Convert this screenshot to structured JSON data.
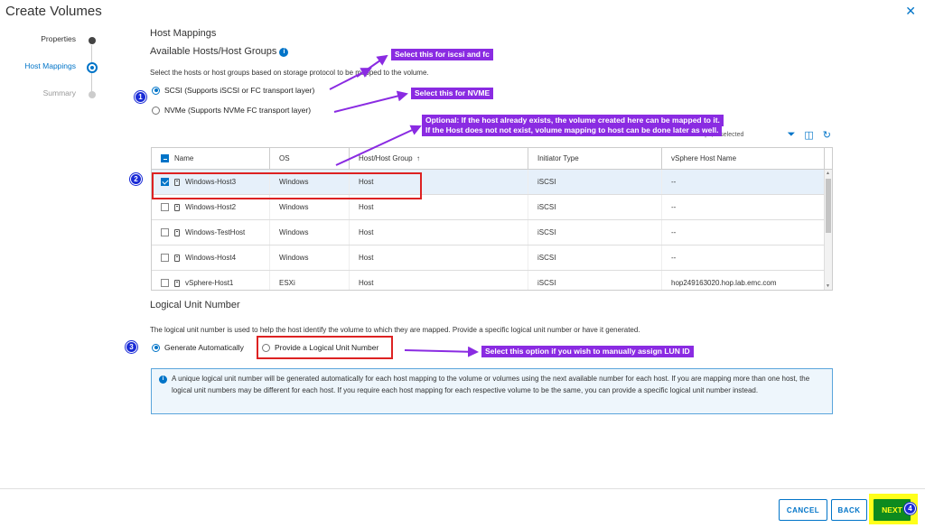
{
  "dialog": {
    "title": "Create Volumes",
    "close_icon": "close-icon"
  },
  "steps": [
    {
      "label": "Properties",
      "state": "done"
    },
    {
      "label": "Host Mappings",
      "state": "active"
    },
    {
      "label": "Summary",
      "state": "future"
    }
  ],
  "section": {
    "heading": "Host Mappings",
    "subheading": "Available Hosts/Host Groups",
    "description": "Select the hosts or host groups based on storage protocol to be mapped to the volume.",
    "protocol_options": [
      {
        "label": "SCSI (Supports iSCSI or FC transport layer)",
        "selected": true
      },
      {
        "label": "NVMe (Supports NVMe FC transport layer)",
        "selected": false
      }
    ],
    "count_text": "5 Hosts & Host Groups, 1 selected"
  },
  "table": {
    "columns": [
      "Name",
      "OS",
      "Host/Host Group",
      "Initiator Type",
      "vSphere Host Name"
    ],
    "sort_indicator": "↑",
    "rows": [
      {
        "name": "Windows-Host3",
        "os": "Windows",
        "group": "Host",
        "initiator": "iSCSI",
        "vsphere": "--",
        "checked": true
      },
      {
        "name": "Windows-Host2",
        "os": "Windows",
        "group": "Host",
        "initiator": "iSCSI",
        "vsphere": "--",
        "checked": false
      },
      {
        "name": "Windows-TestHost",
        "os": "Windows",
        "group": "Host",
        "initiator": "iSCSI",
        "vsphere": "--",
        "checked": false
      },
      {
        "name": "Windows-Host4",
        "os": "Windows",
        "group": "Host",
        "initiator": "iSCSI",
        "vsphere": "--",
        "checked": false
      },
      {
        "name": "vSphere-Host1",
        "os": "ESXi",
        "group": "Host",
        "initiator": "iSCSI",
        "vsphere": "hop249163020.hop.lab.emc.com",
        "checked": false
      }
    ]
  },
  "lun": {
    "heading": "Logical Unit Number",
    "description": "The logical unit number is used to help the host identify the volume to which they are mapped. Provide a specific logical unit number or have it generated.",
    "options": [
      {
        "label": "Generate Automatically",
        "selected": true
      },
      {
        "label": "Provide a Logical Unit Number",
        "selected": false
      }
    ],
    "info": "A unique logical unit number will be generated automatically for each host mapping to the volume or volumes using the next available number for each host. If you are mapping more than one host, the logical unit numbers may be different for each host. If you require each host mapping for each respective volume to be the same, you can provide a specific logical unit number instead."
  },
  "annotations": {
    "callout_iscsi": "Select this for iscsi and fc",
    "callout_nvme": "Select this for NVME",
    "callout_optional_1": "Optional: If the host already exists, the volume created here can be mapped to it.",
    "callout_optional_2": "If the Host does not not exist, volume mapping to host can be done later as well.",
    "callout_lun": "Select this option if you wish to manually assign LUN ID",
    "badges": [
      "1",
      "2",
      "3",
      "4"
    ],
    "arrow_color": "#8a2be2",
    "highlight_color": "#dd2222"
  },
  "footer": {
    "cancel": "CANCEL",
    "back": "BACK",
    "next": "NEXT"
  }
}
